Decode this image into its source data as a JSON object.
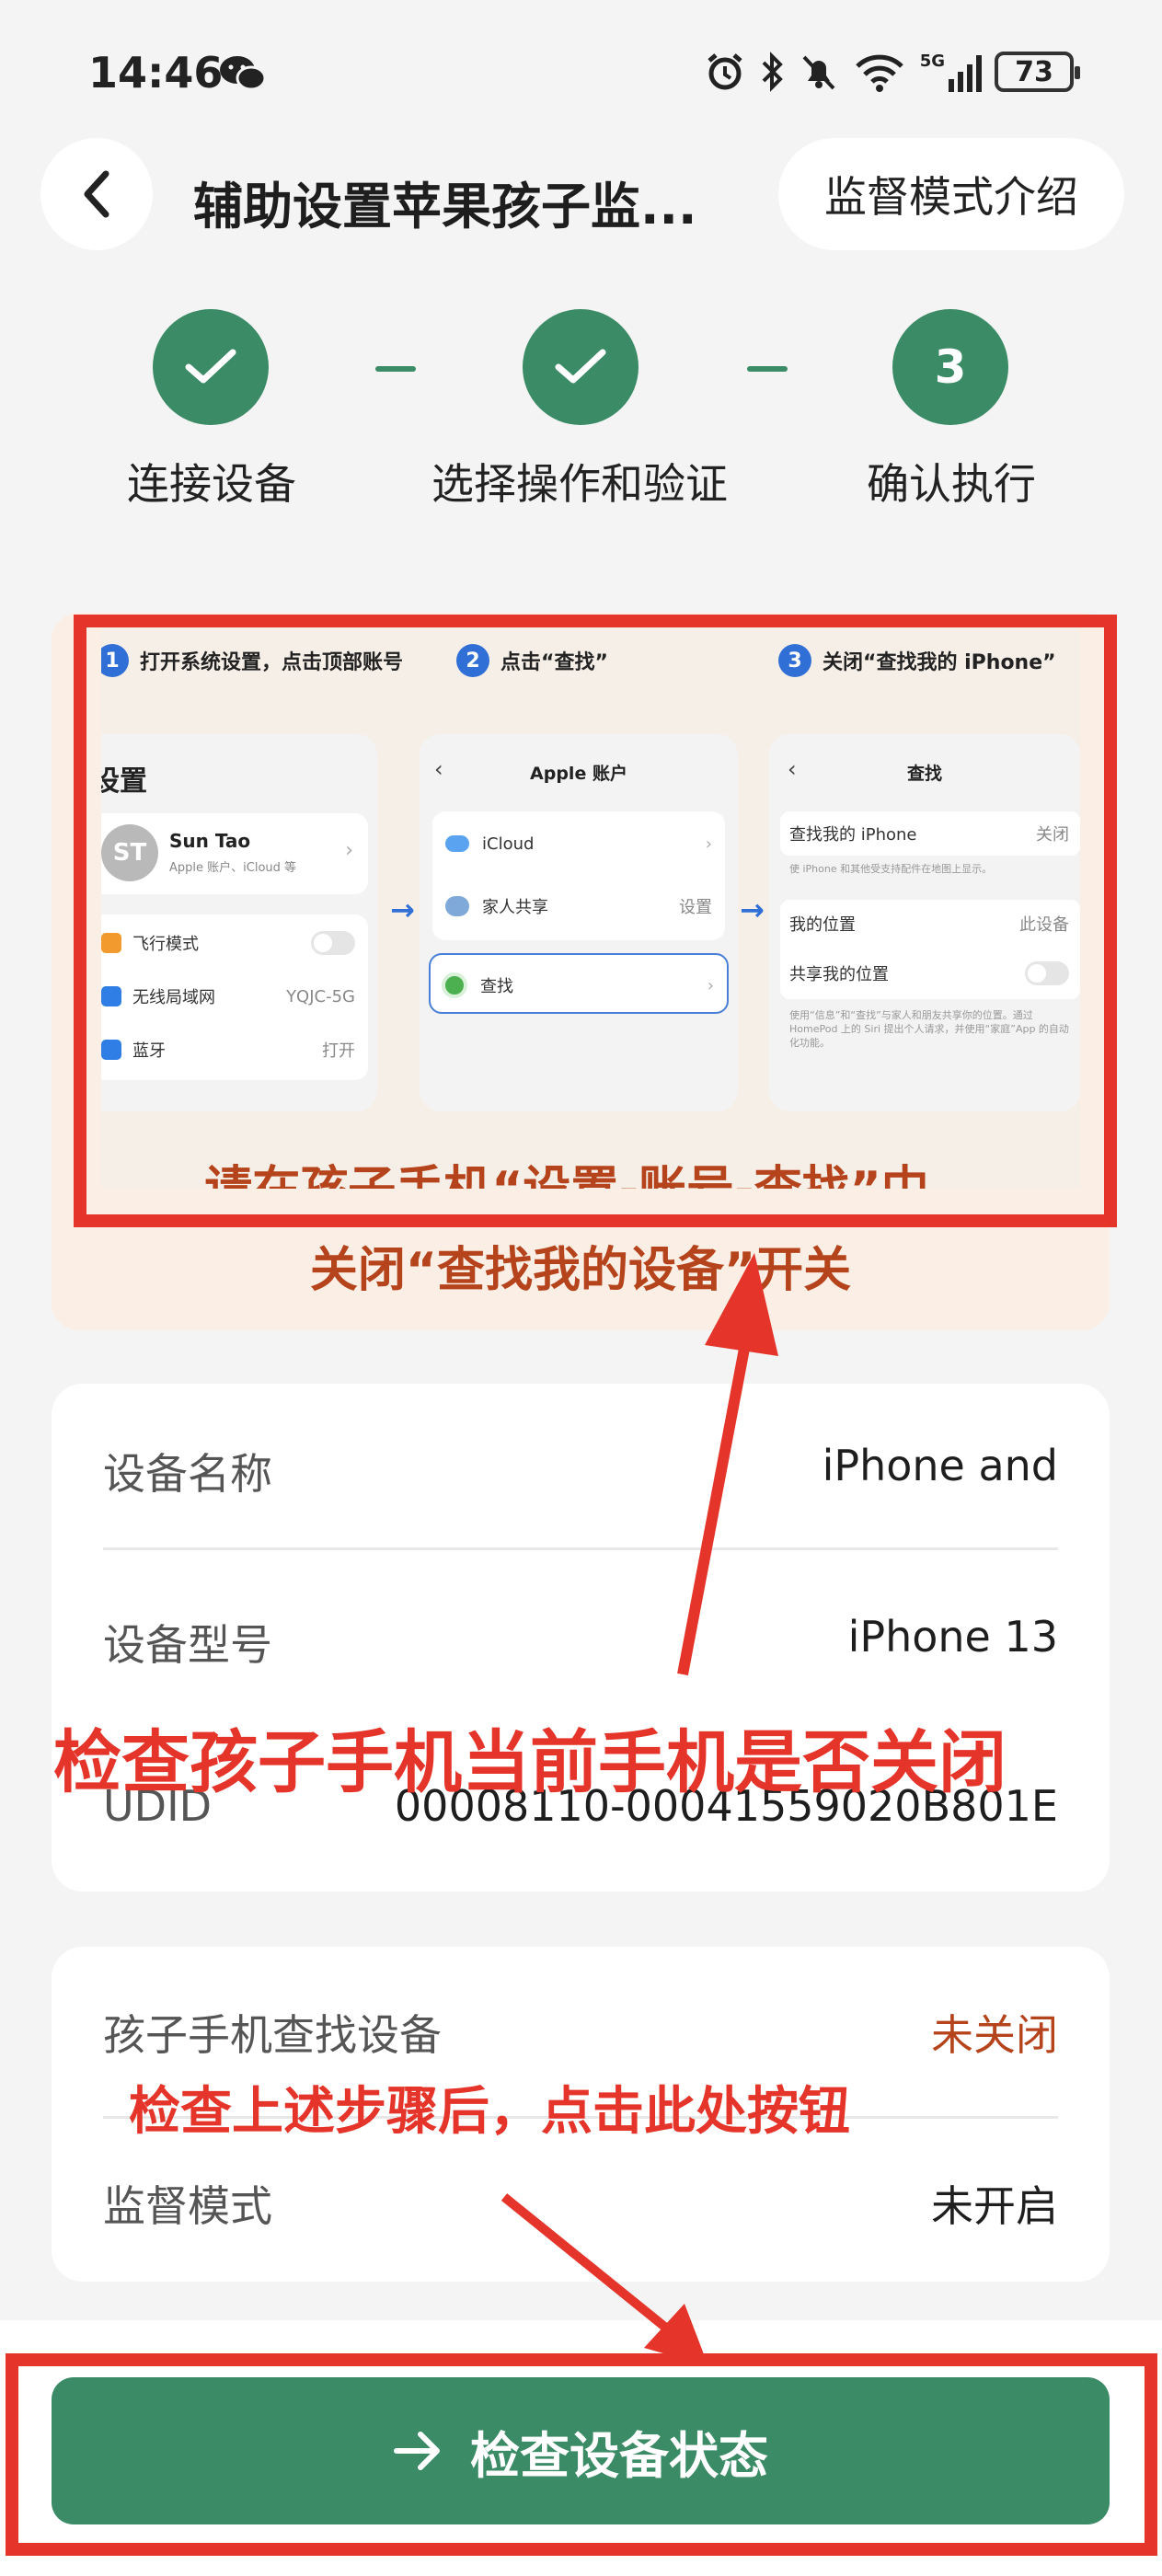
{
  "status_bar": {
    "time": "14:46",
    "network": "5G",
    "battery": "73"
  },
  "header": {
    "title": "辅助设置苹果孩子监...",
    "intro_button": "监督模式介绍"
  },
  "steps": [
    {
      "label": "连接设备",
      "state": "done"
    },
    {
      "label": "选择操作和验证",
      "state": "done"
    },
    {
      "label": "确认执行",
      "state": "current",
      "number": "3"
    }
  ],
  "guide": {
    "step1": {
      "num": "1",
      "title": "打开系统设置，点击顶部账号"
    },
    "step2": {
      "num": "2",
      "title": "点击“查找”"
    },
    "step3": {
      "num": "3",
      "title": "关闭“查找我的 iPhone”"
    },
    "panel1": {
      "heading": "设置",
      "avatar": "ST",
      "user_name": "Sun Tao",
      "user_sub": "Apple 账户、iCloud 等",
      "airplane": "飞行模式",
      "wlan": "无线局域网",
      "wlan_value": "YQJC-5G",
      "bluetooth": "蓝牙",
      "bluetooth_value": "打开"
    },
    "panel2": {
      "heading": "Apple 账户",
      "icloud": "iCloud",
      "family": "家人共享",
      "family_value": "设置",
      "find": "查找"
    },
    "panel3": {
      "heading": "查找",
      "find_iphone": "查找我的 iPhone",
      "find_iphone_value": "关闭",
      "find_iphone_desc": "使 iPhone 和其他受支持配件在地图上显示。",
      "my_location": "我的位置",
      "my_location_value": "此设备",
      "share_location": "共享我的位置",
      "share_desc": "使用“信息”和“查找”与家人和朋友共享你的位置。通过 HomePod 上的 Siri 提出个人请求，并使用“家庭”App 的自动化功能。"
    },
    "caption_line1": "请在孩子手机“设置-账号-查找”中，",
    "caption_line2": "关闭“查找我的设备”开关"
  },
  "device_info": {
    "name_label": "设备名称",
    "name_value": "iPhone and",
    "model_label": "设备型号",
    "model_value": "iPhone 13",
    "udid_label": "UDID",
    "udid_value": "00008110-00041559020B801E"
  },
  "status_info": {
    "find_label": "孩子手机查找设备",
    "find_value": "未关闭",
    "supervise_label": "监督模式",
    "supervise_value": "未开启"
  },
  "annotations": {
    "check_off": "检查孩子手机当前手机是否关闭",
    "click_here": "检查上述步骤后，点击此处按钮"
  },
  "main_button": {
    "label": "检查设备状态"
  },
  "colors": {
    "brand_green": "#3a8b66",
    "warning_orange": "#b5441c",
    "annotation_red": "#e5352b"
  }
}
